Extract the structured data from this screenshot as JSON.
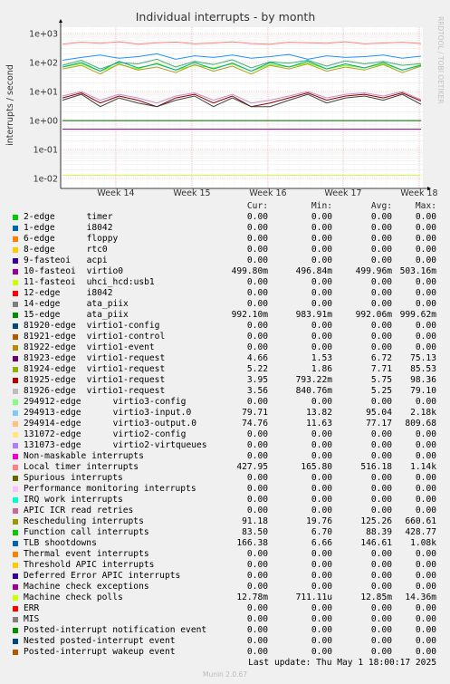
{
  "chart_data": {
    "type": "line",
    "title": "Individual interrupts - by month",
    "ylabel": "interrupts / second",
    "y_scale": "log",
    "y_ticks": [
      "1e-02",
      "1e-01",
      "1e+00",
      "1e+01",
      "1e+02",
      "1e+03"
    ],
    "x_ticks": [
      "Week 14",
      "Week 15",
      "Week 16",
      "Week 17",
      "Week 18"
    ],
    "grid": true,
    "series": [
      {
        "name": "Local timer interrupts",
        "color": "#FF8080",
        "values": [
          428,
          500,
          460,
          520,
          430,
          480,
          510,
          440,
          470,
          520,
          450,
          430,
          500,
          480,
          460,
          520,
          440,
          470,
          500,
          450
        ]
      },
      {
        "name": "TLB shootdowns",
        "color": "#1E90FF",
        "values": [
          120,
          150,
          180,
          140,
          160,
          200,
          130,
          170,
          150,
          180,
          140,
          160,
          190,
          130,
          170,
          150,
          160,
          180,
          140,
          166
        ]
      },
      {
        "name": "Rescheduling interrupts",
        "color": "#3CB371",
        "values": [
          80,
          120,
          60,
          100,
          90,
          130,
          70,
          110,
          85,
          125,
          65,
          105,
          95,
          120,
          75,
          115,
          90,
          110,
          80,
          91
        ]
      },
      {
        "name": "Function call interrupts",
        "color": "#7FFF00",
        "values": [
          70,
          90,
          50,
          85,
          60,
          95,
          55,
          80,
          65,
          90,
          50,
          85,
          70,
          95,
          60,
          80,
          65,
          90,
          55,
          84
        ]
      },
      {
        "name": "virtio3-output.0",
        "color": "#B0A020",
        "values": [
          60,
          80,
          40,
          90,
          55,
          70,
          45,
          85,
          50,
          75,
          40,
          80,
          60,
          90,
          50,
          70,
          55,
          85,
          45,
          75
        ]
      },
      {
        "name": "virtio3-input.0",
        "color": "#00AA88",
        "values": [
          70,
          100,
          50,
          110,
          65,
          90,
          55,
          100,
          60,
          95,
          50,
          100,
          70,
          110,
          60,
          90,
          65,
          100,
          55,
          80
        ]
      },
      {
        "name": "virtio1-request 81923",
        "color": "#8B0000",
        "values": [
          6,
          9,
          4,
          7,
          5,
          3,
          6,
          8,
          4,
          7,
          3,
          4,
          6,
          9,
          5,
          7,
          8,
          6,
          9,
          4.7
        ]
      },
      {
        "name": "virtio1-request 81924",
        "color": "#C88CC8",
        "values": [
          7,
          10,
          5,
          8,
          6,
          4,
          7,
          9,
          5,
          8,
          4,
          5,
          7,
          10,
          6,
          8,
          9,
          7,
          10,
          5.2
        ]
      },
      {
        "name": "virtio1-request 81926",
        "color": "#404040",
        "values": [
          5,
          8,
          3,
          6,
          4,
          3,
          5,
          7,
          3,
          6,
          3,
          3,
          5,
          8,
          4,
          6,
          7,
          5,
          8,
          3.6
        ]
      },
      {
        "name": "ata_piix 15-edge",
        "color": "#006400",
        "values": [
          0.99,
          0.99,
          0.99,
          0.99,
          0.99,
          0.99,
          0.99,
          0.99,
          0.99,
          0.99,
          0.99,
          0.99,
          0.99,
          0.99,
          0.99,
          0.99,
          0.99,
          0.99,
          0.99,
          0.99
        ]
      },
      {
        "name": "virtio0",
        "color": "#800080",
        "values": [
          0.5,
          0.5,
          0.5,
          0.5,
          0.5,
          0.5,
          0.5,
          0.5,
          0.5,
          0.5,
          0.5,
          0.5,
          0.5,
          0.5,
          0.5,
          0.5,
          0.5,
          0.5,
          0.5,
          0.5
        ]
      },
      {
        "name": "Machine check polls",
        "color": "#CCFF33",
        "values": [
          0.0128,
          0.0128,
          0.0128,
          0.0128,
          0.0128,
          0.0128,
          0.0128,
          0.0128,
          0.0128,
          0.0128,
          0.0128,
          0.0128,
          0.0128,
          0.0128,
          0.0128,
          0.0128,
          0.0128,
          0.0128,
          0.0128,
          0.0128
        ]
      }
    ]
  },
  "rrdtool_label": "RRDTOOL / TOBI OETIKER",
  "legend": {
    "headers": [
      "Cur:",
      "Min:",
      "Avg:",
      "Max:"
    ],
    "rows": [
      {
        "irq": "2-edge",
        "name": "timer",
        "color": "#00CC00",
        "cur": "0.00",
        "min": "0.00",
        "avg": "0.00",
        "max": "0.00"
      },
      {
        "irq": "1-edge",
        "name": "i8042",
        "color": "#0066B3",
        "cur": "0.00",
        "min": "0.00",
        "avg": "0.00",
        "max": "0.00"
      },
      {
        "irq": "6-edge",
        "name": "floppy",
        "color": "#FF8000",
        "cur": "0.00",
        "min": "0.00",
        "avg": "0.00",
        "max": "0.00"
      },
      {
        "irq": "8-edge",
        "name": "rtc0",
        "color": "#FFCC00",
        "cur": "0.00",
        "min": "0.00",
        "avg": "0.00",
        "max": "0.00"
      },
      {
        "irq": "9-fasteoi",
        "name": "acpi",
        "color": "#330099",
        "cur": "0.00",
        "min": "0.00",
        "avg": "0.00",
        "max": "0.00"
      },
      {
        "irq": "10-fasteoi",
        "name": "virtio0",
        "color": "#990099",
        "cur": "499.80m",
        "min": "496.84m",
        "avg": "499.96m",
        "max": "503.16m"
      },
      {
        "irq": "11-fasteoi",
        "name": "uhci_hcd:usb1",
        "color": "#CCFF00",
        "cur": "0.00",
        "min": "0.00",
        "avg": "0.00",
        "max": "0.00"
      },
      {
        "irq": "12-edge",
        "name": "i8042",
        "color": "#FF0000",
        "cur": "0.00",
        "min": "0.00",
        "avg": "0.00",
        "max": "0.00"
      },
      {
        "irq": "14-edge",
        "name": "ata_piix",
        "color": "#808080",
        "cur": "0.00",
        "min": "0.00",
        "avg": "0.00",
        "max": "0.00"
      },
      {
        "irq": "15-edge",
        "name": "ata_piix",
        "color": "#008F00",
        "cur": "992.10m",
        "min": "983.91m",
        "avg": "992.06m",
        "max": "999.62m"
      },
      {
        "irq": "81920-edge",
        "name": "virtio1-config",
        "color": "#00487D",
        "cur": "0.00",
        "min": "0.00",
        "avg": "0.00",
        "max": "0.00"
      },
      {
        "irq": "81921-edge",
        "name": "virtio1-control",
        "color": "#B35A00",
        "cur": "0.00",
        "min": "0.00",
        "avg": "0.00",
        "max": "0.00"
      },
      {
        "irq": "81922-edge",
        "name": "virtio1-event",
        "color": "#B38F00",
        "cur": "0.00",
        "min": "0.00",
        "avg": "0.00",
        "max": "0.00"
      },
      {
        "irq": "81923-edge",
        "name": "virtio1-request",
        "color": "#6B006B",
        "cur": "4.66",
        "min": "1.53",
        "avg": "6.72",
        "max": "75.13"
      },
      {
        "irq": "81924-edge",
        "name": "virtio1-request",
        "color": "#8FB300",
        "cur": "5.22",
        "min": "1.86",
        "avg": "7.71",
        "max": "85.53"
      },
      {
        "irq": "81925-edge",
        "name": "virtio1-request",
        "color": "#B30000",
        "cur": "3.95",
        "min": "793.22m",
        "avg": "5.75",
        "max": "98.36"
      },
      {
        "irq": "81926-edge",
        "name": "virtio1-request",
        "color": "#BEBEBE",
        "cur": "3.56",
        "min": "840.76m",
        "avg": "5.25",
        "max": "79.10"
      },
      {
        "irq": "294912-edge",
        "name": "virtio3-config",
        "color": "#80FF80",
        "cur": "0.00",
        "min": "0.00",
        "avg": "0.00",
        "max": "0.00"
      },
      {
        "irq": "294913-edge",
        "name": "virtio3-input.0",
        "color": "#80C9FF",
        "cur": "79.71",
        "min": "13.82",
        "avg": "95.04",
        "max": "2.18k"
      },
      {
        "irq": "294914-edge",
        "name": "virtio3-output.0",
        "color": "#FFC080",
        "cur": "74.76",
        "min": "11.63",
        "avg": "77.17",
        "max": "809.68"
      },
      {
        "irq": "131072-edge",
        "name": "virtio2-config",
        "color": "#FFE680",
        "cur": "0.00",
        "min": "0.00",
        "avg": "0.00",
        "max": "0.00"
      },
      {
        "irq": "131073-edge",
        "name": "virtio2-virtqueues",
        "color": "#AA80FF",
        "cur": "0.00",
        "min": "0.00",
        "avg": "0.00",
        "max": "0.00"
      },
      {
        "irq": "Non-maskable interrupts",
        "name": "",
        "color": "#EE00CC",
        "cur": "0.00",
        "min": "0.00",
        "avg": "0.00",
        "max": "0.00"
      },
      {
        "irq": "Local timer interrupts",
        "name": "",
        "color": "#FF8080",
        "cur": "427.95",
        "min": "165.80",
        "avg": "516.18",
        "max": "1.14k"
      },
      {
        "irq": "Spurious interrupts",
        "name": "",
        "color": "#666600",
        "cur": "0.00",
        "min": "0.00",
        "avg": "0.00",
        "max": "0.00"
      },
      {
        "irq": "Performance monitoring interrupts",
        "name": "",
        "color": "#FFBFFF",
        "cur": "0.00",
        "min": "0.00",
        "avg": "0.00",
        "max": "0.00"
      },
      {
        "irq": "IRQ work interrupts",
        "name": "",
        "color": "#00FFCC",
        "cur": "0.00",
        "min": "0.00",
        "avg": "0.00",
        "max": "0.00"
      },
      {
        "irq": "APIC ICR read retries",
        "name": "",
        "color": "#CC6699",
        "cur": "0.00",
        "min": "0.00",
        "avg": "0.00",
        "max": "0.00"
      },
      {
        "irq": "Rescheduling interrupts",
        "name": "",
        "color": "#999900",
        "cur": "91.18",
        "min": "19.76",
        "avg": "125.26",
        "max": "660.61"
      },
      {
        "irq": "Function call interrupts",
        "name": "",
        "color": "#00CC00",
        "cur": "83.50",
        "min": "6.70",
        "avg": "88.39",
        "max": "428.77"
      },
      {
        "irq": "TLB shootdowns",
        "name": "",
        "color": "#0066B3",
        "cur": "166.38",
        "min": "6.66",
        "avg": "146.61",
        "max": "1.08k"
      },
      {
        "irq": "Thermal event interrupts",
        "name": "",
        "color": "#FF8000",
        "cur": "0.00",
        "min": "0.00",
        "avg": "0.00",
        "max": "0.00"
      },
      {
        "irq": "Threshold APIC interrupts",
        "name": "",
        "color": "#FFCC00",
        "cur": "0.00",
        "min": "0.00",
        "avg": "0.00",
        "max": "0.00"
      },
      {
        "irq": "Deferred Error APIC interrupts",
        "name": "",
        "color": "#330099",
        "cur": "0.00",
        "min": "0.00",
        "avg": "0.00",
        "max": "0.00"
      },
      {
        "irq": "Machine check exceptions",
        "name": "",
        "color": "#990099",
        "cur": "0.00",
        "min": "0.00",
        "avg": "0.00",
        "max": "0.00"
      },
      {
        "irq": "Machine check polls",
        "name": "",
        "color": "#CCFF00",
        "cur": "12.78m",
        "min": "711.11u",
        "avg": "12.85m",
        "max": "14.36m"
      },
      {
        "irq": "ERR",
        "name": "",
        "color": "#FF0000",
        "cur": "0.00",
        "min": "0.00",
        "avg": "0.00",
        "max": "0.00"
      },
      {
        "irq": "MIS",
        "name": "",
        "color": "#808080",
        "cur": "0.00",
        "min": "0.00",
        "avg": "0.00",
        "max": "0.00"
      },
      {
        "irq": "Posted-interrupt notification event",
        "name": "",
        "color": "#008F00",
        "cur": "0.00",
        "min": "0.00",
        "avg": "0.00",
        "max": "0.00"
      },
      {
        "irq": "Nested posted-interrupt event",
        "name": "",
        "color": "#00487D",
        "cur": "0.00",
        "min": "0.00",
        "avg": "0.00",
        "max": "0.00"
      },
      {
        "irq": "Posted-interrupt wakeup event",
        "name": "",
        "color": "#B35A00",
        "cur": "0.00",
        "min": "0.00",
        "avg": "0.00",
        "max": "0.00"
      }
    ]
  },
  "last_update": "Last update: Thu May  1 18:00:17 2025",
  "footer": "Munin 2.0.67"
}
